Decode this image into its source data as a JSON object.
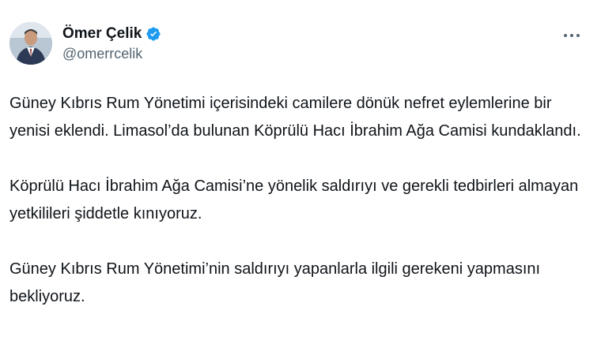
{
  "author": {
    "display_name": "Ömer Çelik",
    "handle": "@omerrcelik",
    "verified": true,
    "verified_color": "#1d9bf0"
  },
  "actions": {
    "more_icon": "more-horizontal-icon"
  },
  "tweet": {
    "paragraphs": [
      "Güney Kıbrıs Rum Yönetimi içerisindeki camilere dönük nefret eylemlerine bir yenisi eklendi. Limasol’da bulunan Köprülü Hacı İbrahim Ağa Camisi kundaklandı.",
      "Köprülü Hacı İbrahim Ağa Camisi’ne yönelik saldırıyı ve gerekli tedbirleri almayan yetkilileri şiddetle kınıyoruz.",
      "Güney Kıbrıs Rum Yönetimi’nin saldırıyı yapanlarla ilgili gerekeni yapmasını bekliyoruz."
    ]
  }
}
